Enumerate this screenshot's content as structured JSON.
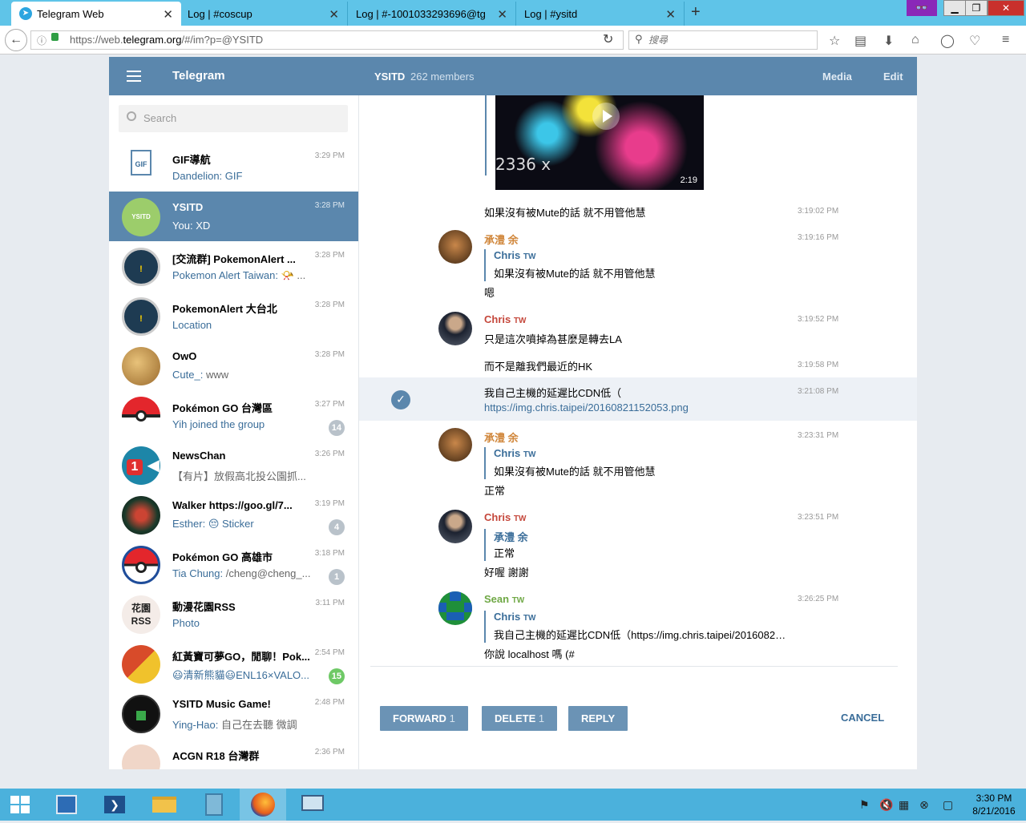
{
  "browser": {
    "tabs": [
      {
        "label": "Telegram Web",
        "active": true
      },
      {
        "label": "Log | #coscup",
        "active": false
      },
      {
        "label": "Log | #-1001033293696@tg",
        "active": false
      },
      {
        "label": "Log | #ysitd",
        "active": false
      }
    ],
    "url_prefix": "https://web.",
    "url_host": "telegram.org",
    "url_path": "/#/im?p=@YSITD",
    "search_placeholder": "搜尋",
    "window_controls": {
      "minimize": "▁",
      "restore": "❐",
      "close": "✕"
    }
  },
  "header": {
    "app_title": "Telegram",
    "chat_title": "YSITD",
    "chat_members": "262 members",
    "media": "Media",
    "edit": "Edit"
  },
  "sidebar": {
    "search_placeholder": "Search",
    "dialogs": [
      {
        "name": "GIF導航",
        "who": "",
        "msg": "Dandelion: GIF",
        "time": "3:29 PM",
        "badge": "",
        "avatar": "GIF"
      },
      {
        "name": "YSITD",
        "who": "You:",
        "msg": "XD",
        "time": "3:28 PM",
        "badge": "",
        "avatar": "YSITD"
      },
      {
        "name": "[交流群] PokemonAlert ...",
        "who": "Pokemon Alert Taiwan:",
        "msg": "📯 ...",
        "time": "3:28 PM",
        "badge": "",
        "avatar": "!"
      },
      {
        "name": "PokemonAlert 大台北",
        "who": "Location",
        "msg": "",
        "time": "3:28 PM",
        "badge": "",
        "avatar": "!"
      },
      {
        "name": "OwO",
        "who": "Cute_:",
        "msg": "www",
        "time": "3:28 PM",
        "badge": "",
        "avatar": ""
      },
      {
        "name": "Pokémon GO 台灣區",
        "who": "Yih joined the group",
        "msg": "",
        "time": "3:27 PM",
        "badge": "14",
        "avatar": ""
      },
      {
        "name": "NewsChan",
        "who": "",
        "msg": "【有片】放假高北投公園抓...",
        "time": "3:26 PM",
        "badge": "",
        "avatar": "1"
      },
      {
        "name": "Walker https://goo.gl/7...",
        "who": "Esther:",
        "msg": "😔 Sticker",
        "time": "3:19 PM",
        "badge": "4",
        "avatar": ""
      },
      {
        "name": "Pokémon GO 高雄市",
        "who": "Tia Chung:",
        "msg": "/cheng@cheng_...",
        "time": "3:18 PM",
        "badge": "1",
        "avatar": ""
      },
      {
        "name": "動漫花園RSS",
        "who": "Photo",
        "msg": "",
        "time": "3:11 PM",
        "badge": "",
        "avatar": "花園 RSS"
      },
      {
        "name": "紅黃寶可夢GO，閒聊！Pok...",
        "who": "",
        "msg": "😃清新熊貓😃ENL16×VALO...",
        "time": "2:54 PM",
        "badge": "15",
        "avatar": ""
      },
      {
        "name": "YSITD Music Game!",
        "who": "Ying-Hao:",
        "msg": "自己在去聽 微調",
        "time": "2:48 PM",
        "badge": "",
        "avatar": ""
      },
      {
        "name": "ACGN R18 台灣群",
        "who": "",
        "msg": "",
        "time": "2:36 PM",
        "badge": "",
        "avatar": ""
      }
    ]
  },
  "messages": {
    "video_duration": "2:19",
    "video_overlay": "2336 x",
    "items": [
      {
        "author": "",
        "tw": "",
        "time": "3:19:02 PM",
        "reply_author": "",
        "reply_tw": "",
        "reply_text": "",
        "text": "如果沒有被Mute的話 就不用管他慧"
      },
      {
        "author": "承澧 余",
        "tw": "",
        "time": "3:19:16 PM",
        "reply_author": "Chris",
        "reply_tw": "TW",
        "reply_text": "如果沒有被Mute的話 就不用管他慧",
        "text": "嗯"
      },
      {
        "author": "Chris",
        "tw": "TW",
        "time": "3:19:52 PM",
        "reply_author": "",
        "reply_tw": "",
        "reply_text": "",
        "text": "只是這次噴掉為甚麼是轉去LA"
      },
      {
        "author": "",
        "tw": "",
        "time": "3:19:58 PM",
        "reply_author": "",
        "reply_tw": "",
        "reply_text": "",
        "text": "而不是離我們最近的HK"
      },
      {
        "author": "",
        "tw": "",
        "time": "3:21:08 PM",
        "reply_author": "",
        "reply_tw": "",
        "reply_text": "",
        "text": "我自己主機的延遲比CDN低（",
        "link": "https://img.chris.taipei/20160821152053.png"
      },
      {
        "author": "承澧 余",
        "tw": "",
        "time": "3:23:31 PM",
        "reply_author": "Chris",
        "reply_tw": "TW",
        "reply_text": "如果沒有被Mute的話 就不用管他慧",
        "text": "正常"
      },
      {
        "author": "Chris",
        "tw": "TW",
        "time": "3:23:51 PM",
        "reply_author": "承澧 余",
        "reply_tw": "",
        "reply_text": "正常",
        "text": "好喔 謝謝"
      },
      {
        "author": "Sean",
        "tw": "TW",
        "time": "3:26:25 PM",
        "reply_author": "Chris",
        "reply_tw": "TW",
        "reply_text": "我自己主機的延遲比CDN低（https://img.chris.taipei/20160821...",
        "text": "你說 localhost 嗎 (#"
      }
    ]
  },
  "actions": {
    "forward": "FORWARD",
    "forward_count": "1",
    "delete": "DELETE",
    "delete_count": "1",
    "reply": "REPLY",
    "cancel": "CANCEL"
  },
  "taskbar": {
    "time": "3:30 PM",
    "date": "8/21/2016"
  },
  "colors": {
    "header": "#5b87ad",
    "selected_dialog": "#5b87ad",
    "author_orange": "#d0863a",
    "author_red": "#c5473b",
    "author_green": "#6fa845",
    "link": "#3a6d99",
    "taskbar": "#4bb1dc"
  }
}
